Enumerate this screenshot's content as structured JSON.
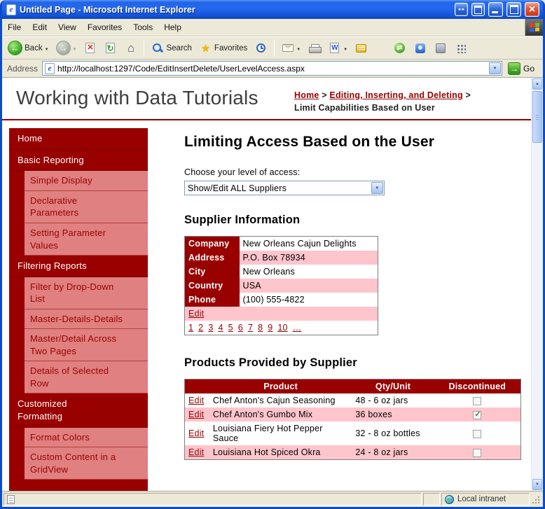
{
  "window": {
    "title": "Untitled Page - Microsoft Internet Explorer"
  },
  "menu": {
    "items": [
      "File",
      "Edit",
      "View",
      "Favorites",
      "Tools",
      "Help"
    ]
  },
  "toolbar": {
    "back": "Back",
    "search": "Search",
    "favorites": "Favorites"
  },
  "address": {
    "label": "Address",
    "url": "http://localhost:1297/Code/EditInsertDelete/UserLevelAccess.aspx",
    "go": "Go"
  },
  "status": {
    "zone": "Local intranet"
  },
  "colors": {
    "accent_maroon": "#990000",
    "row_alt_pink": "#ffc5cc",
    "titlebar_blue": "#1e63e0"
  },
  "page": {
    "site_title": "Working with Data Tutorials",
    "breadcrumb": {
      "home": "Home",
      "separator": ">",
      "section": "Editing, Inserting, and Deleting",
      "current": "Limit Capabilities Based on User"
    },
    "sidebar": [
      {
        "label": "Home",
        "type": "top"
      },
      {
        "label": "Basic Reporting",
        "type": "top"
      },
      {
        "label": "Simple Display",
        "type": "sub"
      },
      {
        "label": "Declarative Parameters",
        "type": "sub"
      },
      {
        "label": "Setting Parameter Values",
        "type": "sub"
      },
      {
        "label": "Filtering Reports",
        "type": "top"
      },
      {
        "label": "Filter by Drop-Down List",
        "type": "sub"
      },
      {
        "label": "Master-Details-Details",
        "type": "sub"
      },
      {
        "label": "Master/Detail Across Two Pages",
        "type": "sub"
      },
      {
        "label": "Details of Selected Row",
        "type": "sub"
      },
      {
        "label": "Customized Formatting",
        "type": "top"
      },
      {
        "label": "Format Colors",
        "type": "sub"
      },
      {
        "label": "Custom Content in a GridView",
        "type": "sub"
      }
    ],
    "main": {
      "title": "Limiting Access Based on the User",
      "access_label": "Choose your level of access:",
      "access_value": "Show/Edit ALL Suppliers",
      "supplier_heading": "Supplier Information",
      "supplier": {
        "rows": [
          {
            "label": "Company",
            "value": "New Orleans Cajun Delights"
          },
          {
            "label": "Address",
            "value": "P.O. Box 78934"
          },
          {
            "label": "City",
            "value": "New Orleans"
          },
          {
            "label": "Country",
            "value": "USA"
          },
          {
            "label": "Phone",
            "value": "(100) 555-4822"
          }
        ],
        "edit_label": "Edit",
        "pager": [
          "1",
          "2",
          "3",
          "4",
          "5",
          "6",
          "7",
          "8",
          "9",
          "10",
          "…"
        ]
      },
      "products_heading": "Products Provided by Supplier",
      "products": {
        "headers": [
          "",
          "Product",
          "Qty/Unit",
          "Discontinued"
        ],
        "edit_label": "Edit",
        "rows": [
          {
            "product": "Chef Anton's Cajun Seasoning",
            "qty": "48 - 6 oz jars",
            "discontinued": false
          },
          {
            "product": "Chef Anton's Gumbo Mix",
            "qty": "36 boxes",
            "discontinued": true
          },
          {
            "product": "Louisiana Fiery Hot Pepper Sauce",
            "qty": "32 - 8 oz bottles",
            "discontinued": false
          },
          {
            "product": "Louisiana Hot Spiced Okra",
            "qty": "24 - 8 oz jars",
            "discontinued": false
          }
        ]
      }
    }
  }
}
